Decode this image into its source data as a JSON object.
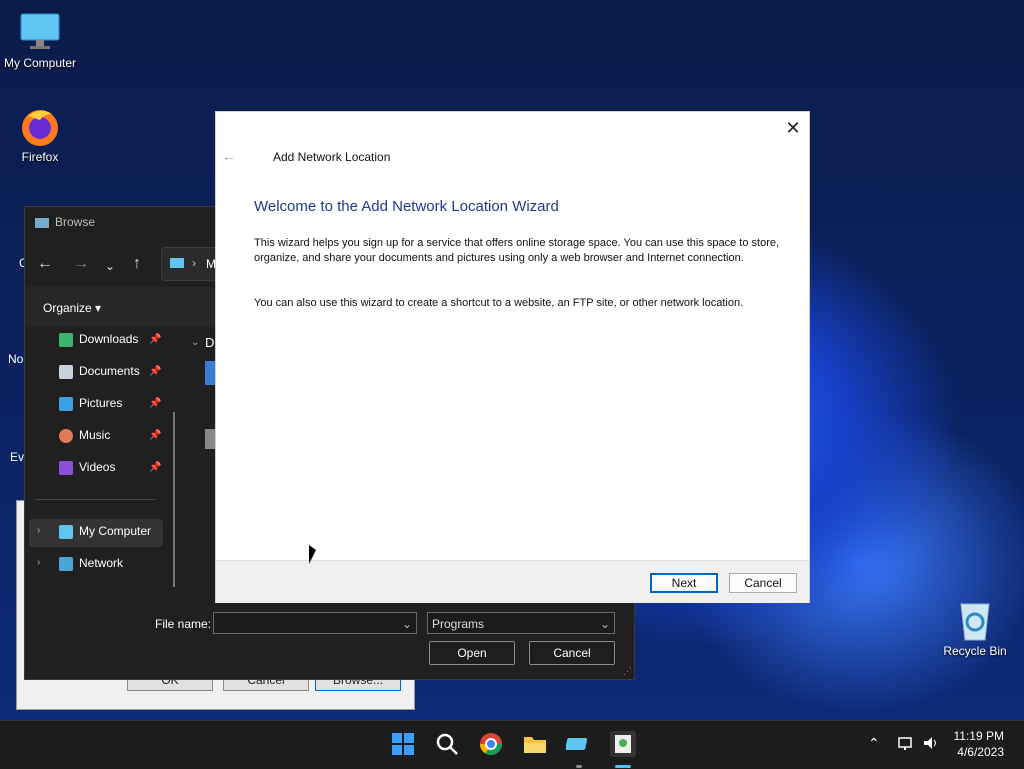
{
  "desktop": {
    "icons": [
      {
        "label": "My Computer"
      },
      {
        "label": "Firefox"
      },
      {
        "label": "Recycle Bin"
      }
    ],
    "partial_labels": [
      "G",
      "No",
      "Ev"
    ]
  },
  "back_dialog": {
    "buttons": [
      "OK",
      "Cancel",
      "Browse..."
    ]
  },
  "browse": {
    "title": "Browse",
    "address_fragment": "M",
    "organize_label": "Organize",
    "content_header_fragment": "D",
    "quick_access": [
      {
        "label": "Downloads",
        "icon": "download-icon"
      },
      {
        "label": "Documents",
        "icon": "documents-icon"
      },
      {
        "label": "Pictures",
        "icon": "pictures-icon"
      },
      {
        "label": "Music",
        "icon": "music-icon"
      },
      {
        "label": "Videos",
        "icon": "videos-icon"
      }
    ],
    "tree": [
      {
        "label": "My Computer",
        "icon": "computer-icon",
        "selected": true
      },
      {
        "label": "Network",
        "icon": "network-icon",
        "selected": false
      }
    ],
    "file_name_label": "File name:",
    "file_name_value": "",
    "file_type_value": "Programs",
    "open_label": "Open",
    "cancel_label": "Cancel"
  },
  "wizard": {
    "window_title": "Add Network Location",
    "heading": "Welcome to the Add Network Location Wizard",
    "paragraph1": "This wizard helps you sign up for a service that offers online storage space.  You can use this space to store, organize, and share your documents and pictures using only a web browser and Internet connection.",
    "paragraph2": "You can also use this wizard to create a shortcut to a website, an FTP site, or other network location.",
    "next_label": "Next",
    "cancel_label": "Cancel",
    "heading_color": "#1e3b8a"
  },
  "taskbar": {
    "apps": [
      "start-icon",
      "search-icon",
      "chrome-icon",
      "file-explorer-icon",
      "control-panel-icon",
      "wizard-app-icon"
    ],
    "time": "11:19 PM",
    "date": "4/6/2023"
  }
}
